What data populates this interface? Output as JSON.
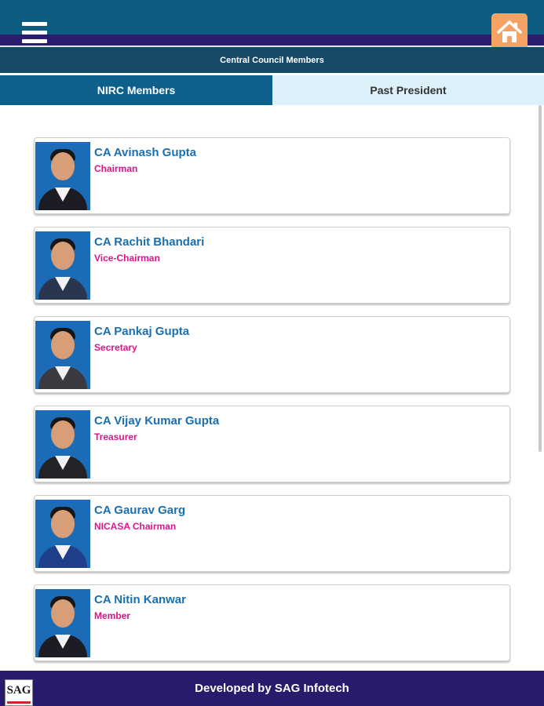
{
  "header": {
    "subtitle": "Central Council Members",
    "menu_icon": "hamburger-menu-icon",
    "home_icon": "home-icon",
    "colors": {
      "topbar": "#0d5c82",
      "stripe": "#2a1d6e",
      "home_button": "#f4a365"
    }
  },
  "tabs": [
    {
      "label": "NIRC Members",
      "active": true
    },
    {
      "label": "Past President",
      "active": false
    }
  ],
  "members": [
    {
      "name": "CA Avinash Gupta",
      "role": "Chairman"
    },
    {
      "name": "CA Rachit Bhandari",
      "role": "Vice-Chairman"
    },
    {
      "name": "CA Pankaj Gupta",
      "role": "Secretary"
    },
    {
      "name": "CA Vijay Kumar Gupta",
      "role": "Treasurer"
    },
    {
      "name": "CA Gaurav Garg",
      "role": "NICASA Chairman"
    },
    {
      "name": "CA Nitin Kanwar",
      "role": "Member"
    }
  ],
  "footer": {
    "text": "Developed by SAG Infotech",
    "logo_text": "SAG",
    "color": "#271b6c"
  }
}
